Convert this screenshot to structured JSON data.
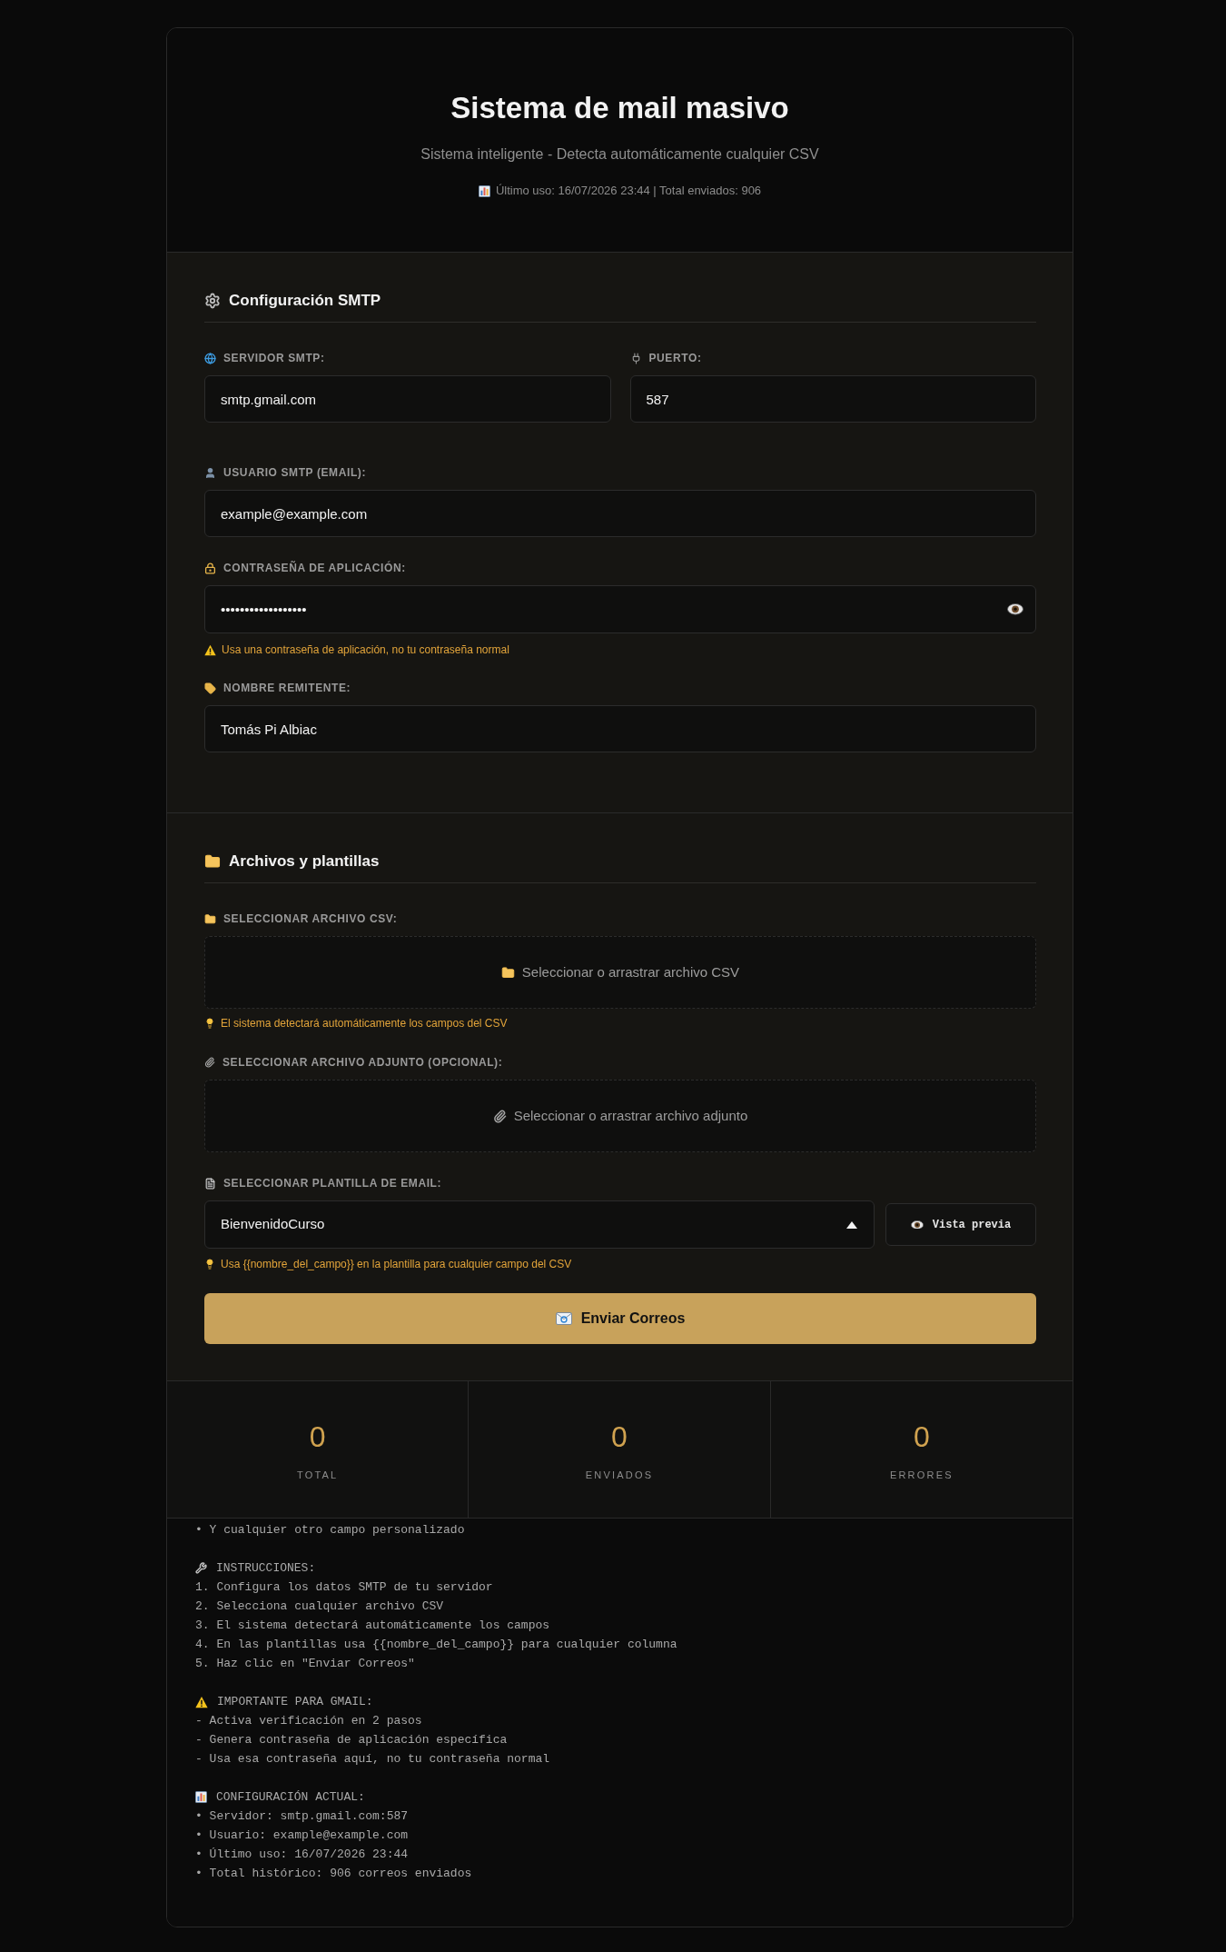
{
  "header": {
    "title": "Sistema de mail masivo",
    "subtitle": "Sistema inteligente - Detecta automáticamente cualquier CSV",
    "meta": "Último uso: 16/07/2026 23:44 | Total enviados: 906"
  },
  "smtp": {
    "title": "Configuración SMTP",
    "fields": [
      {
        "kind": "server",
        "label": "SERVIDOR SMTP:",
        "value": "smtp.gmail.com"
      },
      {
        "kind": "port",
        "label": "PUERTO:",
        "value": "587"
      },
      {
        "kind": "user",
        "label": "USUARIO SMTP (EMAIL):",
        "value": "example@example.com"
      },
      {
        "kind": "password",
        "label": "CONTRASEÑA DE APLICACIÓN:",
        "value": "••••••••••••••••••",
        "hint": "Usa una contraseña de aplicación, no tu contraseña normal"
      },
      {
        "kind": "sender",
        "label": "NOMBRE REMITENTE:",
        "value": "Tomás Pi Albiac"
      }
    ]
  },
  "files": {
    "title": "Archivos y plantillas",
    "csv": {
      "label": "SELECCIONAR ARCHIVO CSV:",
      "drop_text": "Seleccionar o arrastrar archivo CSV",
      "hint": "El sistema detectará automáticamente los campos del CSV"
    },
    "attachment": {
      "label": "SELECCIONAR ARCHIVO ADJUNTO (OPCIONAL):",
      "drop_text": "Seleccionar o arrastrar archivo adjunto"
    },
    "template": {
      "label": "SELECCIONAR PLANTILLA DE EMAIL:",
      "value": "BienvenidoCurso",
      "preview_button": "Vista previa",
      "hint": "Usa {{nombre_del_campo}} en la plantilla para cualquier campo del CSV"
    },
    "send_button": "Enviar Correos"
  },
  "stats": [
    {
      "value": "0",
      "label": "TOTAL"
    },
    {
      "value": "0",
      "label": "ENVIADOS"
    },
    {
      "value": "0",
      "label": "ERRORES"
    }
  ],
  "log": {
    "blocks": [
      {
        "lines": [
          "• Y cualquier otro campo personalizado"
        ]
      },
      {
        "kind": "instructions",
        "heading": "INSTRUCCIONES:",
        "lines": [
          "1. Configura los datos SMTP de tu servidor",
          "2. Selecciona cualquier archivo CSV",
          "3. El sistema detectará automáticamente los campos",
          "4. En las plantillas usa {{nombre_del_campo}} para cualquier columna",
          "5. Haz clic en \"Enviar Correos\""
        ]
      },
      {
        "kind": "warning",
        "heading": "IMPORTANTE PARA GMAIL:",
        "lines": [
          "- Activa verificación en 2 pasos",
          "- Genera contraseña de aplicación específica",
          "- Usa esa contraseña aquí, no tu contraseña normal"
        ]
      },
      {
        "kind": "config",
        "heading": "CONFIGURACIÓN ACTUAL:",
        "lines": [
          "• Servidor: smtp.gmail.com:587",
          "• Usuario: example@example.com",
          "• Último uso: 16/07/2026 23:44",
          "• Total histórico: 906 correos enviados"
        ]
      }
    ]
  }
}
